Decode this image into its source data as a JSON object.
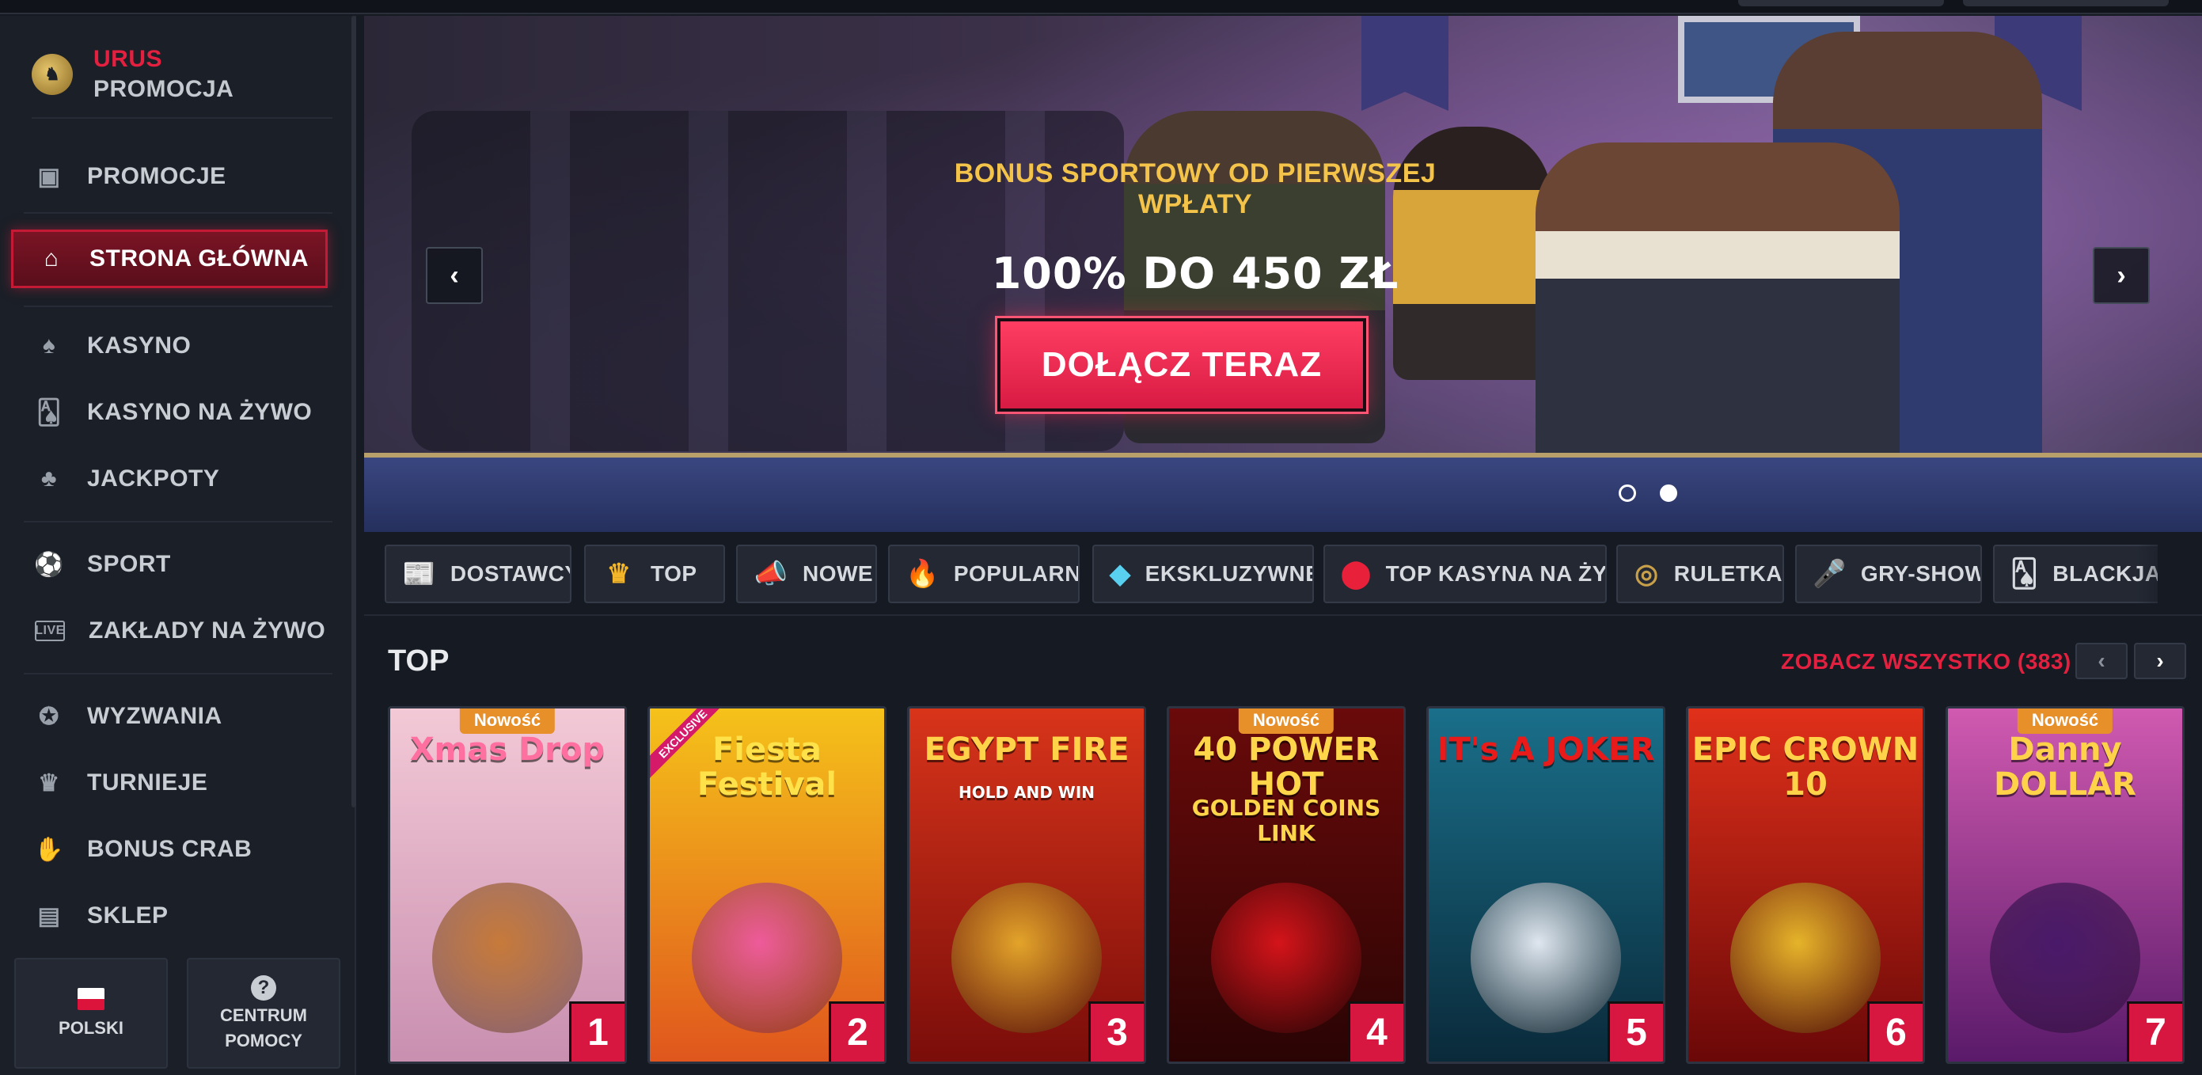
{
  "brand": {
    "line1": "URUS",
    "line2": "PROMOCJA",
    "logo_icon": "bull-logo-icon"
  },
  "sidebar": {
    "items": [
      {
        "label": "PROMOCJE",
        "icon": "gift-icon"
      },
      {
        "label": "STRONA GŁÓWNA",
        "icon": "home-icon",
        "active": true
      },
      {
        "label": "KASYNO",
        "icon": "spade-icon"
      },
      {
        "label": "KASYNO NA ŻYWO",
        "icon": "cards-icon"
      },
      {
        "label": "JACKPOTY",
        "icon": "clover-icon"
      },
      {
        "label": "SPORT",
        "icon": "football-icon"
      },
      {
        "label": "ZAKŁADY NA ŻYWO",
        "icon": "live-icon"
      },
      {
        "label": "WYZWANIA",
        "icon": "gear-badge-icon"
      },
      {
        "label": "TURNIEJE",
        "icon": "trophy-icon"
      },
      {
        "label": "BONUS CRAB",
        "icon": "crab-icon"
      },
      {
        "label": "SKLEP",
        "icon": "shop-icon"
      }
    ],
    "language_label": "POLSKI",
    "help_label_1": "CENTRUM",
    "help_label_2": "POMOCY"
  },
  "hero": {
    "kicker": "BONUS SPORTOWY OD PIERWSZEJ WPŁATY",
    "title": "100% DO 450 ZŁ",
    "cta": "DOŁĄCZ TERAZ",
    "prev": "‹",
    "next": "›",
    "slides_total": 2,
    "active_slide": 2
  },
  "categories": [
    {
      "label": "DOSTAWCY",
      "icon": "newspaper-icon"
    },
    {
      "label": "TOP",
      "icon": "crown-icon"
    },
    {
      "label": "NOWE",
      "icon": "megaphone-icon"
    },
    {
      "label": "POPULARNE",
      "icon": "fire-icon"
    },
    {
      "label": "EKSKLUZYWNE",
      "icon": "diamond-icon"
    },
    {
      "label": "TOP KASYNA NA ŻYWO",
      "icon": "chip-icon"
    },
    {
      "label": "RULETKA",
      "icon": "roulette-icon"
    },
    {
      "label": "GRY-SHOW",
      "icon": "microphone-icon"
    },
    {
      "label": "BLACKJACK",
      "icon": "cards-icon"
    }
  ],
  "section": {
    "title": "TOP",
    "see_all": "ZOBACZ WSZYSTKO (383)",
    "prev": "‹",
    "next": "›"
  },
  "games": [
    {
      "title": "Xmas Drop",
      "rank": "1",
      "badge": "Nowość",
      "colors": [
        "#f3c9d6",
        "#c98fb0"
      ],
      "title_color": "#ff6fa0",
      "art_color": "#c77a3a"
    },
    {
      "title": "Fiesta Festival",
      "rank": "2",
      "badge_ex": "EXCLUSIVE",
      "colors": [
        "#f5c21a",
        "#e0561d"
      ],
      "title_color": "#ffe14a",
      "art_color": "#ee5b9a"
    },
    {
      "title": "EGYPT FIRE",
      "subtitle": "HOLD AND WIN",
      "rank": "3",
      "colors": [
        "#d8341a",
        "#7a0d0a"
      ],
      "title_color": "#ffd24a",
      "art_color": "#e3a42a"
    },
    {
      "title": "40 POWER HOT",
      "subtitle": "GOLDEN COINS LINK",
      "rank": "4",
      "badge": "Nowość",
      "colors": [
        "#6a0a0a",
        "#2a0404"
      ],
      "title_color": "#ffd54a",
      "art_color": "#d4141a"
    },
    {
      "title": "IT's A JOKER",
      "rank": "5",
      "colors": [
        "#1a6f8a",
        "#0a2a3a"
      ],
      "title_color": "#e81a1a",
      "art_color": "#dfe6ef"
    },
    {
      "title": "EPIC CROWN 10",
      "rank": "6",
      "colors": [
        "#e0301a",
        "#6a0808"
      ],
      "title_color": "#ffd24a",
      "art_color": "#e6b42a"
    },
    {
      "title": "Danny DOLLAR",
      "rank": "7",
      "badge": "Nowość",
      "colors": [
        "#d05ab0",
        "#5a1a6a"
      ],
      "title_color": "#ffd24a",
      "art_color": "#4a1a6a"
    }
  ]
}
